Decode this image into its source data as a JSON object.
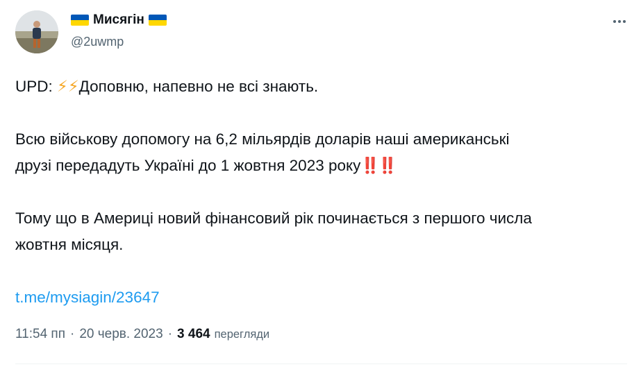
{
  "author": {
    "name": "Мисягін",
    "handle": "@2uwmp",
    "flag_colors": [
      "#0057b7",
      "#ffd700"
    ]
  },
  "tweet": {
    "para1_prefix": "UPD: ",
    "para1_emoji": "⚡⚡",
    "para1_text": "Доповню, напевно не всі знають.",
    "para2_line1": "Всю військову допомогу на 6,2 мільярдів доларів наші американські",
    "para2_line2": "друзі передадуть Україні до 1 жовтня 2023 року",
    "para2_emoji": "‼️‼️",
    "para3_line1": "Тому що в Америці новий фінансовий рік починається з першого числа",
    "para3_line2": "жовтня місяця.",
    "link": "t.me/mysiagin/23647"
  },
  "meta": {
    "time": "11:54 пп",
    "separator": "·",
    "date": "20 черв. 2023",
    "views_count": "3 464",
    "views_label": "перегляди"
  },
  "icons": {
    "more": "more-horizontal-icon"
  }
}
